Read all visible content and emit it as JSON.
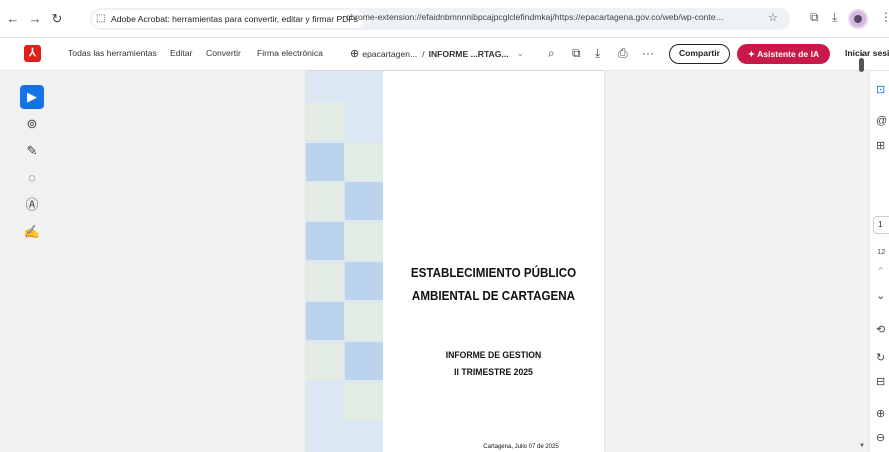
{
  "browser": {
    "tab_title": "Adobe Acrobat: herramientas para convertir, editar y firmar PDFs",
    "url": "chrome-extension://efaidnbmnnnibpcajpcglclefindmkaj/https://epacartagena.gov.co/web/wp-conte…"
  },
  "toolbar": {
    "logo": "⅄",
    "items": [
      "Todas las herramientas",
      "Editar",
      "Convertir",
      "Firma electrónica"
    ],
    "doc_site": "epacartagen...",
    "doc_sep": "/",
    "doc_name": "INFORME ...RTAG...",
    "doc_chevron": "⌄",
    "share_label": "Compartir",
    "ai_label": "Asistente de IA",
    "signin_label": "Iniciar sesió",
    "more": "···"
  },
  "left_tools": [
    {
      "name": "select-tool",
      "glyph": "▶"
    },
    {
      "name": "zoom-comment-tool",
      "glyph": "⊚"
    },
    {
      "name": "pencil-tool",
      "glyph": "✎"
    },
    {
      "name": "lasso-tool",
      "glyph": "◌"
    },
    {
      "name": "text-box-tool",
      "glyph": "Ⓐ"
    },
    {
      "name": "sign-tool",
      "glyph": "✍"
    }
  ],
  "document": {
    "title_line1": "ESTABLECIMIENTO PÚBLICO",
    "title_line2": "AMBIENTAL DE CARTAGENA",
    "subtitle_line1": "INFORME  DE GESTION",
    "subtitle_line2": "II TRIMESTRE 2025",
    "date": "Cartagena, Julio 07 de 2025"
  },
  "right_panel": {
    "page_number": "1",
    "page_count": "12"
  },
  "colors": {
    "accent": "#1473e6",
    "ai_button": "#c9194a",
    "acrobat_red": "#e0201b",
    "tile_blue": "#bcd3ee",
    "tile_green": "#e2ebe4"
  }
}
